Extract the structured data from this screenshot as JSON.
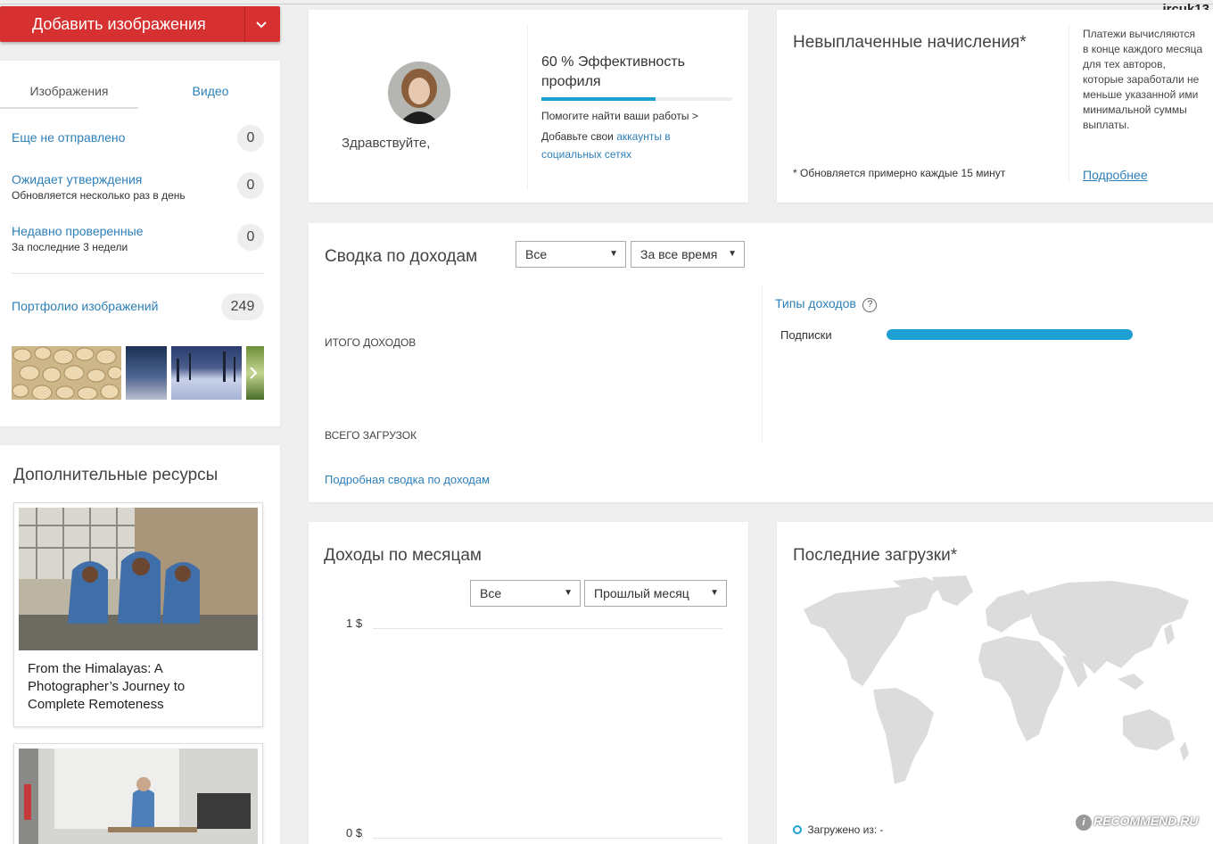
{
  "header": {
    "username": "jrcuk13",
    "add_button_label": "Добавить изображения"
  },
  "media_tabs": [
    {
      "label": "Изображения",
      "active": true
    },
    {
      "label": "Видео",
      "active": false
    }
  ],
  "status_list": [
    {
      "label": "Еще не отправлено",
      "sub": "",
      "count": "0"
    },
    {
      "label": "Ожидает утверждения",
      "sub": "Обновляется несколько раз в день",
      "count": "0"
    },
    {
      "label": "Недавно проверенные",
      "sub": "За последние 3 недели",
      "count": "0"
    }
  ],
  "portfolio": {
    "label": "Портфолио изображений",
    "count": "249"
  },
  "resources": {
    "title": "Дополнительные ресурсы",
    "articles": [
      {
        "title": "From the Himalayas: A Photographer’s Journey to Complete Remoteness"
      }
    ]
  },
  "profile": {
    "greeting": "Здравствуйте,",
    "efficiency_label": "60 % Эффективность профиля",
    "efficiency_value": 0.6,
    "help_text": "Помогите найти ваши работы >",
    "add_text": "Добавьте свои",
    "add_link": "аккаунты в социальных сетях"
  },
  "unpaid": {
    "title": "Невыплаченные начисления*",
    "note": "* Обновляется примерно каждые 15 минут",
    "info": "Платежи вычисляются в конце каждого месяца для тех авторов, которые заработали не меньше указанной ими минимальной суммы выплаты.",
    "more_link": "Подробнее"
  },
  "earnings_summary": {
    "title": "Сводка по доходам",
    "filter_type": "Все",
    "filter_period": "За все время",
    "total_earnings_label": "ИТОГО ДОХОДОВ",
    "total_downloads_label": "ВСЕГО ЗАГРУЗОК",
    "detail_link": "Подробная сводка по доходам",
    "types_title": "Типы доходов",
    "help_icon": "?",
    "types": [
      {
        "label": "Подписки",
        "share": 1.0,
        "color": "#1e9fd2"
      }
    ]
  },
  "monthly": {
    "title": "Доходы по месяцам",
    "filter_type": "Все",
    "filter_period": "Прошлый месяц",
    "y_top": "1 $",
    "y_bottom": "0 $"
  },
  "recent": {
    "title": "Последние загрузки*",
    "legend": "Загружено из: -"
  },
  "watermark": "RECOMMEND.RU",
  "colors": {
    "accent_red": "#d63030",
    "link_blue": "#2d7fb8",
    "bar_blue": "#1e9fd2"
  }
}
